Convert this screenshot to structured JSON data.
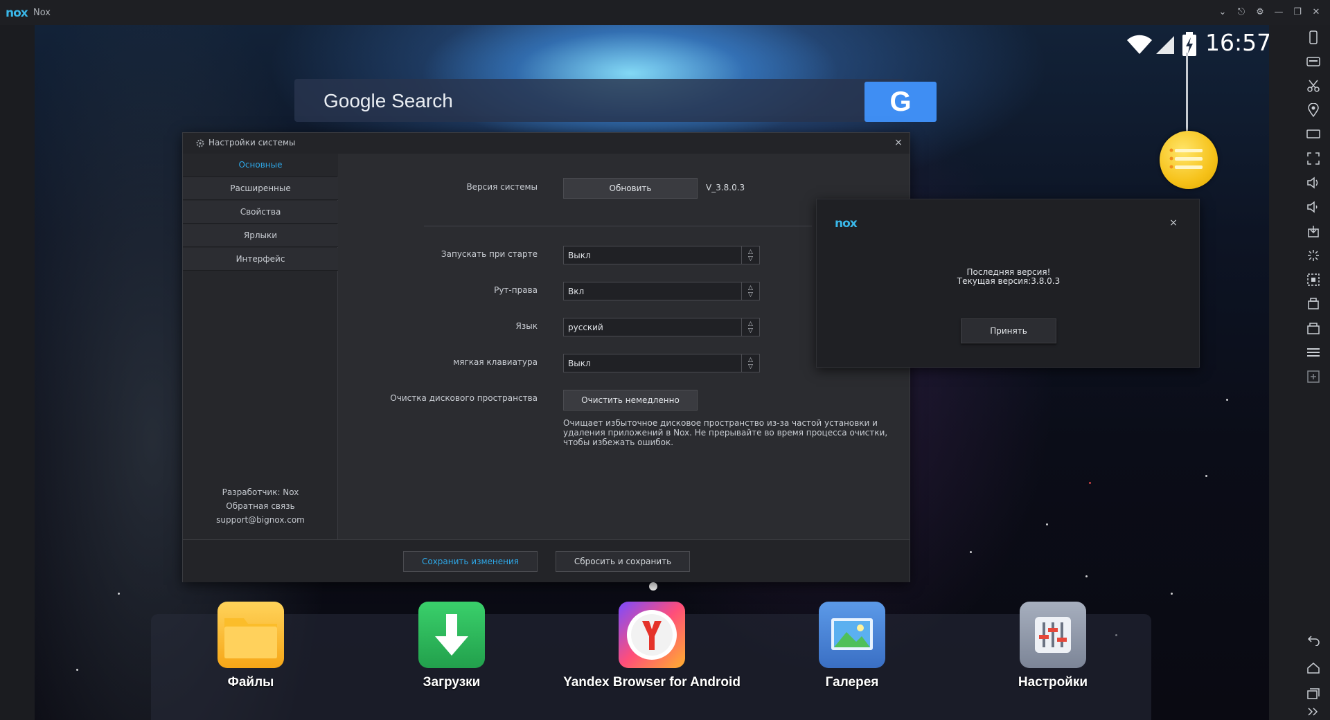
{
  "window": {
    "logo": "nox",
    "title": "Nox"
  },
  "status_bar": {
    "time": "16:57"
  },
  "search_widget": {
    "label": "Google Search",
    "button_letter": "G"
  },
  "settings": {
    "title": "Настройки системы",
    "close": "×",
    "nav": [
      {
        "label": "Основные",
        "active": true
      },
      {
        "label": "Расширенные"
      },
      {
        "label": "Свойства"
      },
      {
        "label": "Ярлыки"
      },
      {
        "label": "Интерфейс"
      }
    ],
    "footer_info": {
      "developer": "Разработчик: Nox",
      "feedback": "Обратная связь",
      "email": "support@bignox.com"
    },
    "system_version": {
      "label": "Версия системы",
      "button": "Обновить",
      "version": "V_3.8.0.3"
    },
    "autostart": {
      "label": "Запускать при старте",
      "value": "Выкл"
    },
    "root": {
      "label": "Рут-права",
      "value": "Вкл"
    },
    "language": {
      "label": "Язык",
      "value": "русский"
    },
    "soft_keyboard": {
      "label": "мягкая клавиатура",
      "value": "Выкл"
    },
    "disk_cleanup": {
      "label": "Очистка дискового пространства",
      "button": "Очистить немедленно",
      "description": "Очищает избыточное дисковое пространство из-за частой установки и удаления приложений в Nox. Не прерывайте во время процесса очистки, чтобы избежать ошибок."
    },
    "save_button": "Сохранить изменения",
    "reset_button": "Сбросить и сохранить"
  },
  "update_popup": {
    "logo": "nox",
    "close": "×",
    "message_line1": "Последняя версия!",
    "message_line2": "Текущая версия:3.8.0.3",
    "accept_button": "Принять"
  },
  "dock": [
    {
      "label": "Файлы",
      "icon": "folder-icon",
      "color": "#f8b62a"
    },
    {
      "label": "Загрузки",
      "icon": "download-icon",
      "color": "#2db85c"
    },
    {
      "label": "Yandex Browser for Android",
      "icon": "yandex-browser-icon",
      "color": "#e5332a"
    },
    {
      "label": "Галерея",
      "icon": "gallery-icon",
      "color": "#4a86d8"
    },
    {
      "label": "Настройки",
      "icon": "settings-icon",
      "color": "#8e97a8"
    }
  ],
  "colors": {
    "accent": "#2ea8e8",
    "nox_logo": "#3ab7e8",
    "google_button": "#3f8ef3"
  }
}
